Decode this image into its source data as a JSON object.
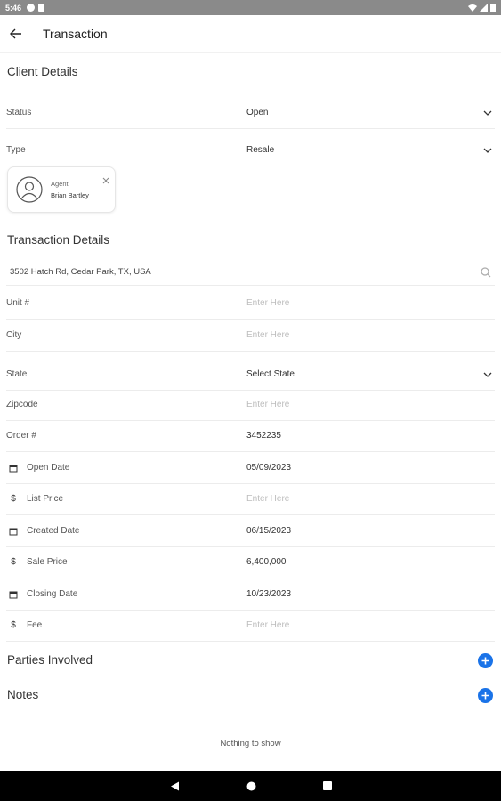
{
  "status_bar": {
    "time": "5:46"
  },
  "app_bar": {
    "title": "Transaction"
  },
  "client_details": {
    "heading": "Client Details",
    "status_label": "Status",
    "status_value": "Open",
    "type_label": "Type",
    "type_value": "Resale",
    "agent": {
      "role": "Agent",
      "name": "Brian Bartley"
    }
  },
  "transaction_details": {
    "heading": "Transaction Details",
    "address": "3502 Hatch Rd, Cedar Park, TX, USA",
    "fields": [
      {
        "label": "Unit #",
        "value": "",
        "placeholder": "Enter Here"
      },
      {
        "label": "City",
        "value": "",
        "placeholder": "Enter Here"
      },
      {
        "label": "State",
        "value": "Select State"
      },
      {
        "label": "Zipcode",
        "value": "",
        "placeholder": "Enter Here"
      },
      {
        "label": "Order #",
        "value": "3452235"
      },
      {
        "label": "Open Date",
        "value": "05/09/2023",
        "icon": "calendar-icon"
      },
      {
        "label": "List Price",
        "value": "",
        "placeholder": "Enter Here",
        "icon": "dollar-icon"
      },
      {
        "label": "Created Date",
        "value": "06/15/2023",
        "icon": "calendar-icon"
      },
      {
        "label": "Sale Price",
        "value": "6,400,000",
        "icon": "dollar-icon"
      },
      {
        "label": "Closing Date",
        "value": "10/23/2023",
        "icon": "calendar-icon"
      },
      {
        "label": "Fee",
        "value": "",
        "placeholder": "Enter Here",
        "icon": "dollar-icon"
      }
    ]
  },
  "parties": {
    "heading": "Parties Involved"
  },
  "notes": {
    "heading": "Notes",
    "empty_text": "Nothing to show"
  },
  "colors": {
    "accent": "#1a73e8",
    "status_bar": "#8a8a8a",
    "nav_bar": "#000000"
  },
  "icons": [
    "back-arrow-icon",
    "chevron-down-icon",
    "person-icon",
    "close-icon",
    "search-icon",
    "calendar-icon",
    "dollar-icon",
    "plus-icon",
    "nav-back-icon",
    "nav-home-icon",
    "nav-recents-icon"
  ]
}
